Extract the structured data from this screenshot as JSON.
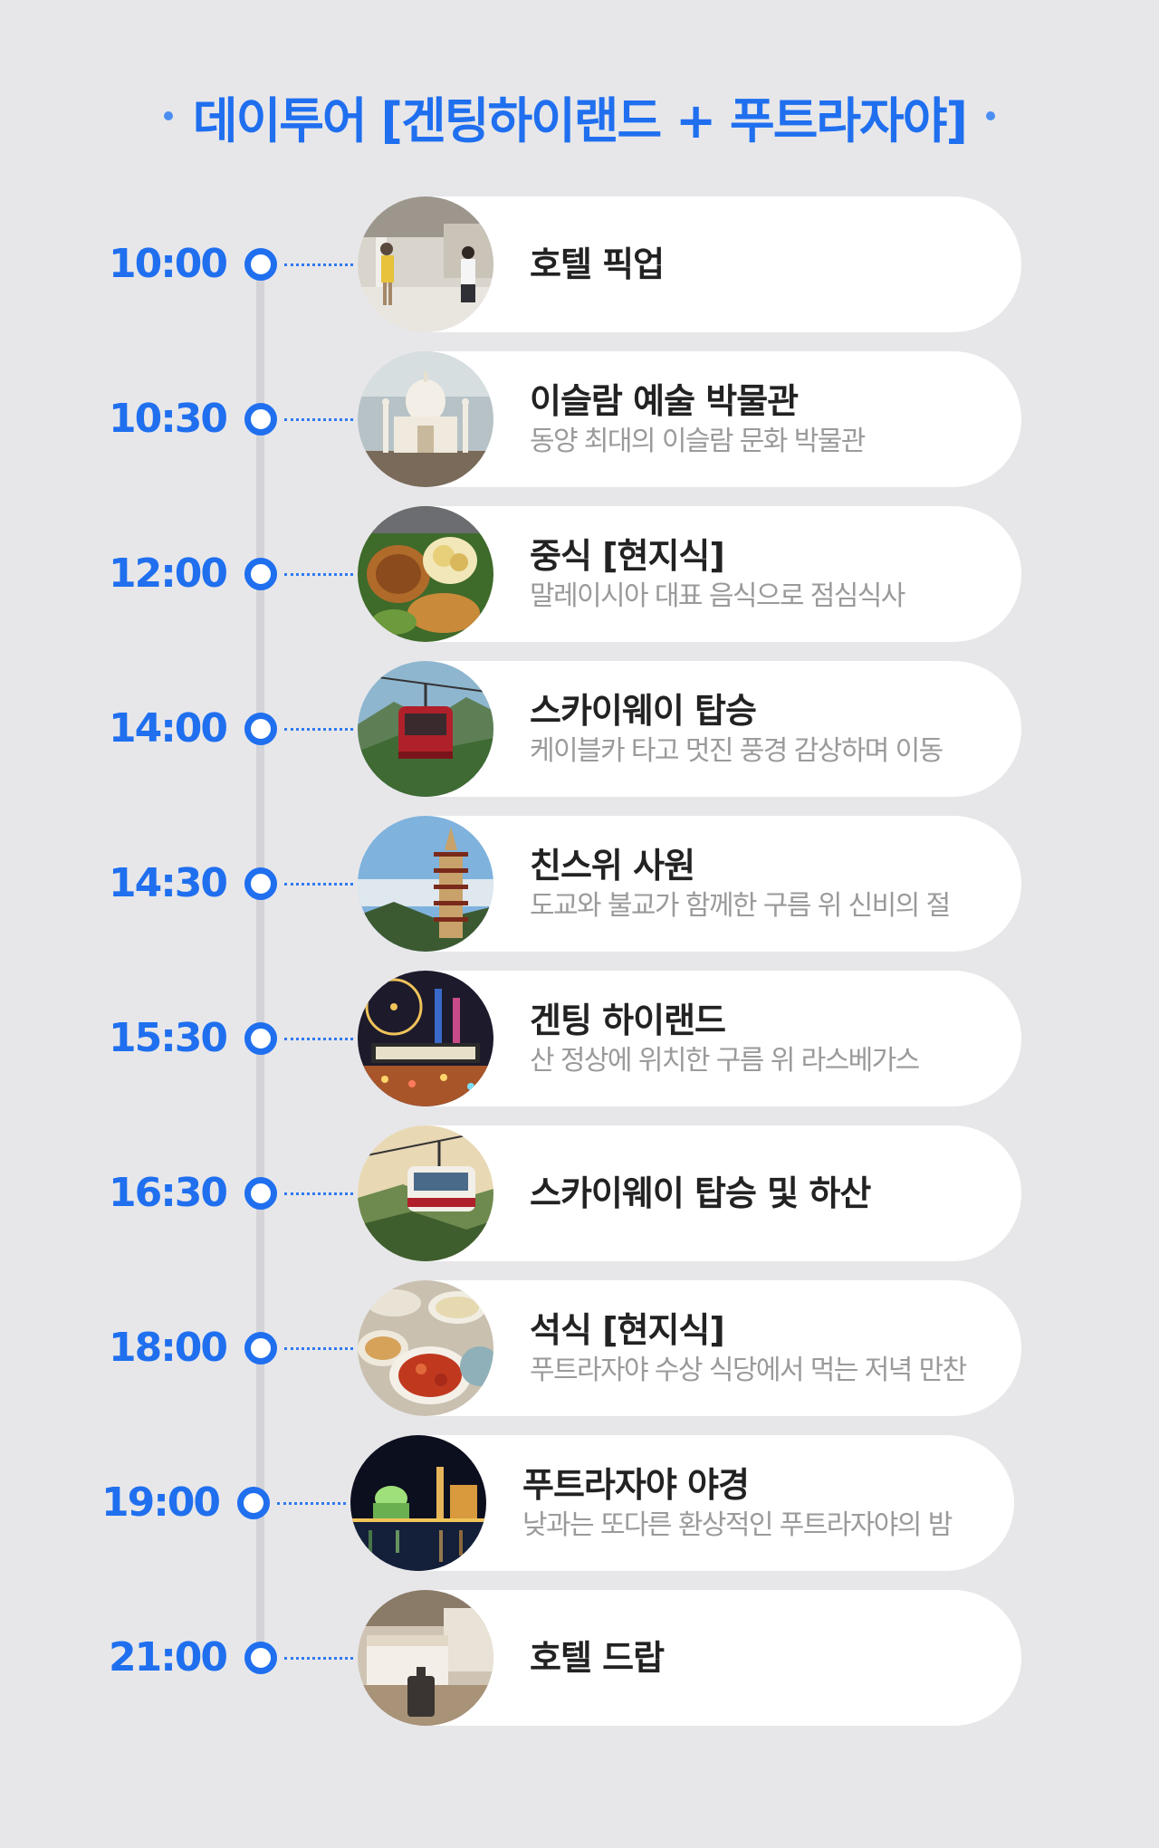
{
  "header": {
    "title": "데이투어 [겐팅하이랜드 + 푸트라자야]"
  },
  "colors": {
    "accent": "#1f6fef",
    "background": "#e7e7ea",
    "card": "#ffffff",
    "title_text": "#222222",
    "desc_text": "#9a9a9a"
  },
  "schedule": [
    {
      "time": "10:00",
      "title": "호텔 픽업",
      "desc": "",
      "photo": "hotel-lobby-photo"
    },
    {
      "time": "10:30",
      "title": "이슬람 예술 박물관",
      "desc": "동양 최대의 이슬람 문화 박물관",
      "photo": "taj-mahal-model-photo"
    },
    {
      "time": "12:00",
      "title": "중식 [현지식]",
      "desc": "말레이시아 대표 음식으로 점심식사",
      "photo": "malaysian-food-photo"
    },
    {
      "time": "14:00",
      "title": "스카이웨이 탑승",
      "desc": "케이블카 타고 멋진 풍경 감상하며 이동",
      "photo": "cable-car-photo"
    },
    {
      "time": "14:30",
      "title": "친스위 사원",
      "desc": "도교와 불교가 함께한 구름 위 신비의 절",
      "photo": "pagoda-photo"
    },
    {
      "time": "15:30",
      "title": "겐팅 하이랜드",
      "desc": "산 정상에 위치한 구름 위 라스베가스",
      "photo": "skytropolis-photo"
    },
    {
      "time": "16:30",
      "title": "스카이웨이 탑승 및 하산",
      "desc": "",
      "photo": "gondola-photo"
    },
    {
      "time": "18:00",
      "title": "석식 [현지식]",
      "desc": "푸트라자야 수상 식당에서 먹는 저녁 만찬",
      "photo": "dinner-dishes-photo"
    },
    {
      "time": "19:00",
      "title": "푸트라자야 야경",
      "desc": "낮과는 또다른 환상적인 푸트라자야의 밤",
      "photo": "night-view-photo"
    },
    {
      "time": "21:00",
      "title": "호텔 드랍",
      "desc": "",
      "photo": "hotel-room-photo"
    }
  ]
}
